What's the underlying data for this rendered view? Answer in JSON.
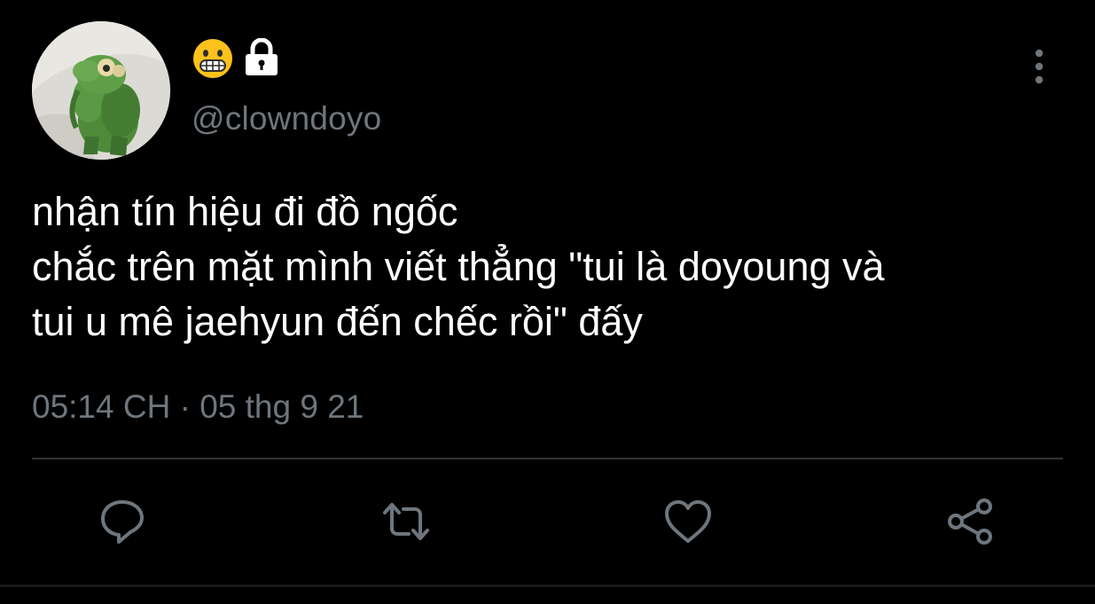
{
  "user": {
    "handle": "@clowndoyo",
    "name_emoji": "grimacing-face-emoji",
    "protected_icon": "lock-icon"
  },
  "tweet": {
    "lines": [
      "nhận tín hiệu đi đồ ngốc",
      "chắc trên mặt mình viết thẳng \"tui là doyoung và",
      "tui u mê jaehyun đến chếc rồi\" đấy"
    ],
    "timestamp": "05:14 CH · 05 thg 9 21"
  },
  "actions": {
    "icons": [
      "reply-icon",
      "retweet-icon",
      "like-icon",
      "share-icon"
    ],
    "more_icon": "more-vertical-icon"
  },
  "colors": {
    "background": "#000000",
    "text": "#ffffff",
    "secondary": "#6e767d",
    "divider": "#2f3336"
  }
}
